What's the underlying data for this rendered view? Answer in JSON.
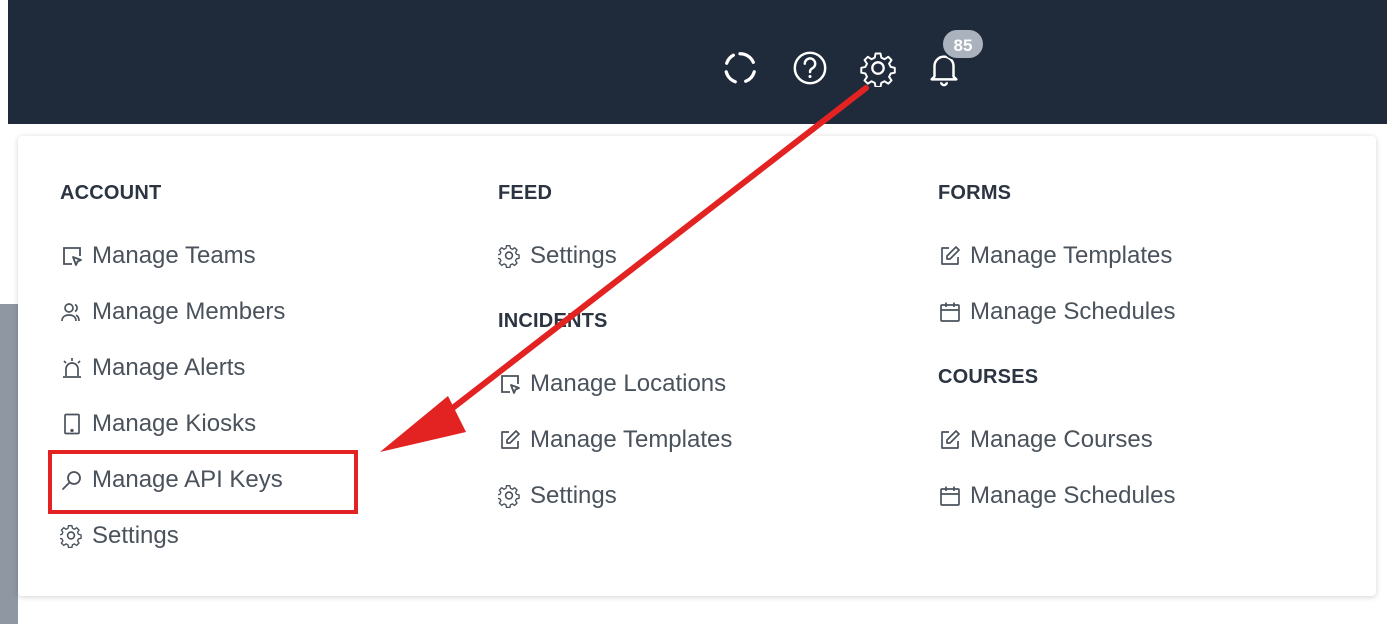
{
  "topbar": {
    "badge_count": "85",
    "icons": [
      "loading-ring-icon",
      "help-icon",
      "gear-icon",
      "bell-icon"
    ],
    "bg_color": "#1f2a3a"
  },
  "menu": {
    "account": {
      "heading": "ACCOUNT",
      "items": [
        {
          "label": "Manage Teams",
          "icon": "cursor-select-icon"
        },
        {
          "label": "Manage Members",
          "icon": "users-icon"
        },
        {
          "label": "Manage Alerts",
          "icon": "alarm-icon"
        },
        {
          "label": "Manage Kiosks",
          "icon": "tablet-icon"
        },
        {
          "label": "Manage API Keys",
          "icon": "key-icon"
        },
        {
          "label": "Settings",
          "icon": "gear-icon"
        }
      ]
    },
    "feed": {
      "heading": "FEED",
      "items": [
        {
          "label": "Settings",
          "icon": "gear-icon"
        }
      ]
    },
    "incidents": {
      "heading": "INCIDENTS",
      "items": [
        {
          "label": "Manage Locations",
          "icon": "cursor-select-icon"
        },
        {
          "label": "Manage Templates",
          "icon": "edit-icon"
        },
        {
          "label": "Settings",
          "icon": "gear-icon"
        }
      ]
    },
    "forms": {
      "heading": "FORMS",
      "items": [
        {
          "label": "Manage Templates",
          "icon": "edit-icon"
        },
        {
          "label": "Manage Schedules",
          "icon": "calendar-icon"
        }
      ]
    },
    "courses": {
      "heading": "COURSES",
      "items": [
        {
          "label": "Manage Courses",
          "icon": "edit-icon"
        },
        {
          "label": "Manage Schedules",
          "icon": "calendar-icon"
        }
      ]
    }
  },
  "annotation": {
    "highlight_color": "#e32222"
  }
}
